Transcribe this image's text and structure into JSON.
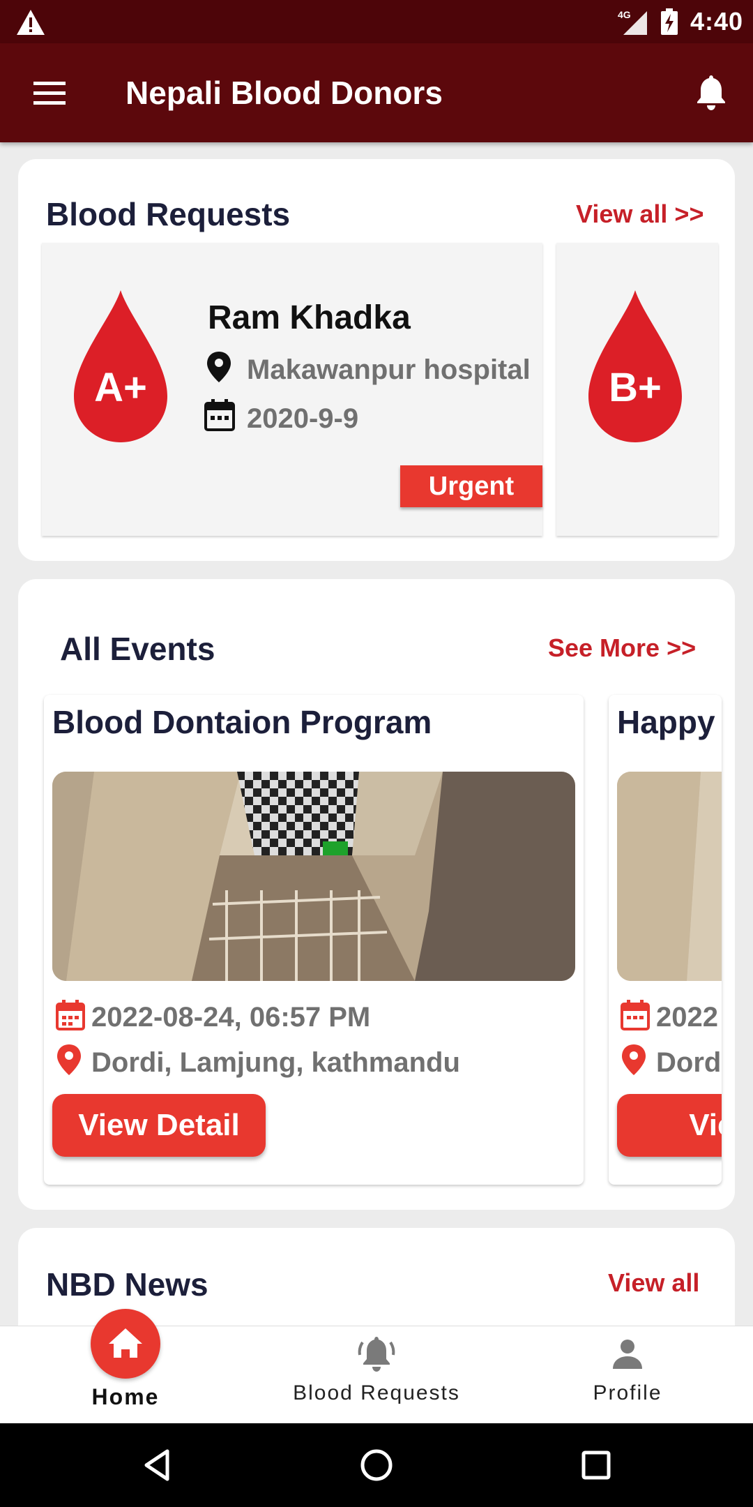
{
  "status_bar": {
    "time": "4:40",
    "network": "4G"
  },
  "app_bar": {
    "title": "Nepali Blood Donors"
  },
  "blood_requests": {
    "heading": "Blood Requests",
    "view_all": "View all >>",
    "items": [
      {
        "group": "A+",
        "name": "Ram Khadka",
        "location": "Makawanpur hospital",
        "date": "2020-9-9",
        "badge": "Urgent"
      },
      {
        "group": "B+"
      }
    ]
  },
  "events": {
    "heading": "All Events",
    "see_more": "See More >>",
    "items": [
      {
        "title": "Blood Dontaion Program",
        "datetime": "2022-08-24, 06:57 PM",
        "location": "Dordi, Lamjung, kathmandu",
        "button": "View Detail"
      },
      {
        "title": "Happy",
        "datetime": "2022",
        "location": "Dordi",
        "button": "View"
      }
    ]
  },
  "news": {
    "heading": "NBD News",
    "view_all": "View all"
  },
  "bottom_nav": {
    "items": [
      {
        "label": "Home",
        "icon": "home-icon",
        "active": true
      },
      {
        "label": "Blood Requests",
        "icon": "bell-ring-icon"
      },
      {
        "label": "Profile",
        "icon": "person-icon"
      }
    ]
  },
  "colors": {
    "primary_dark": "#5c080c",
    "accent": "#e8382f",
    "drop": "#dc1f27",
    "link": "#c62028"
  }
}
